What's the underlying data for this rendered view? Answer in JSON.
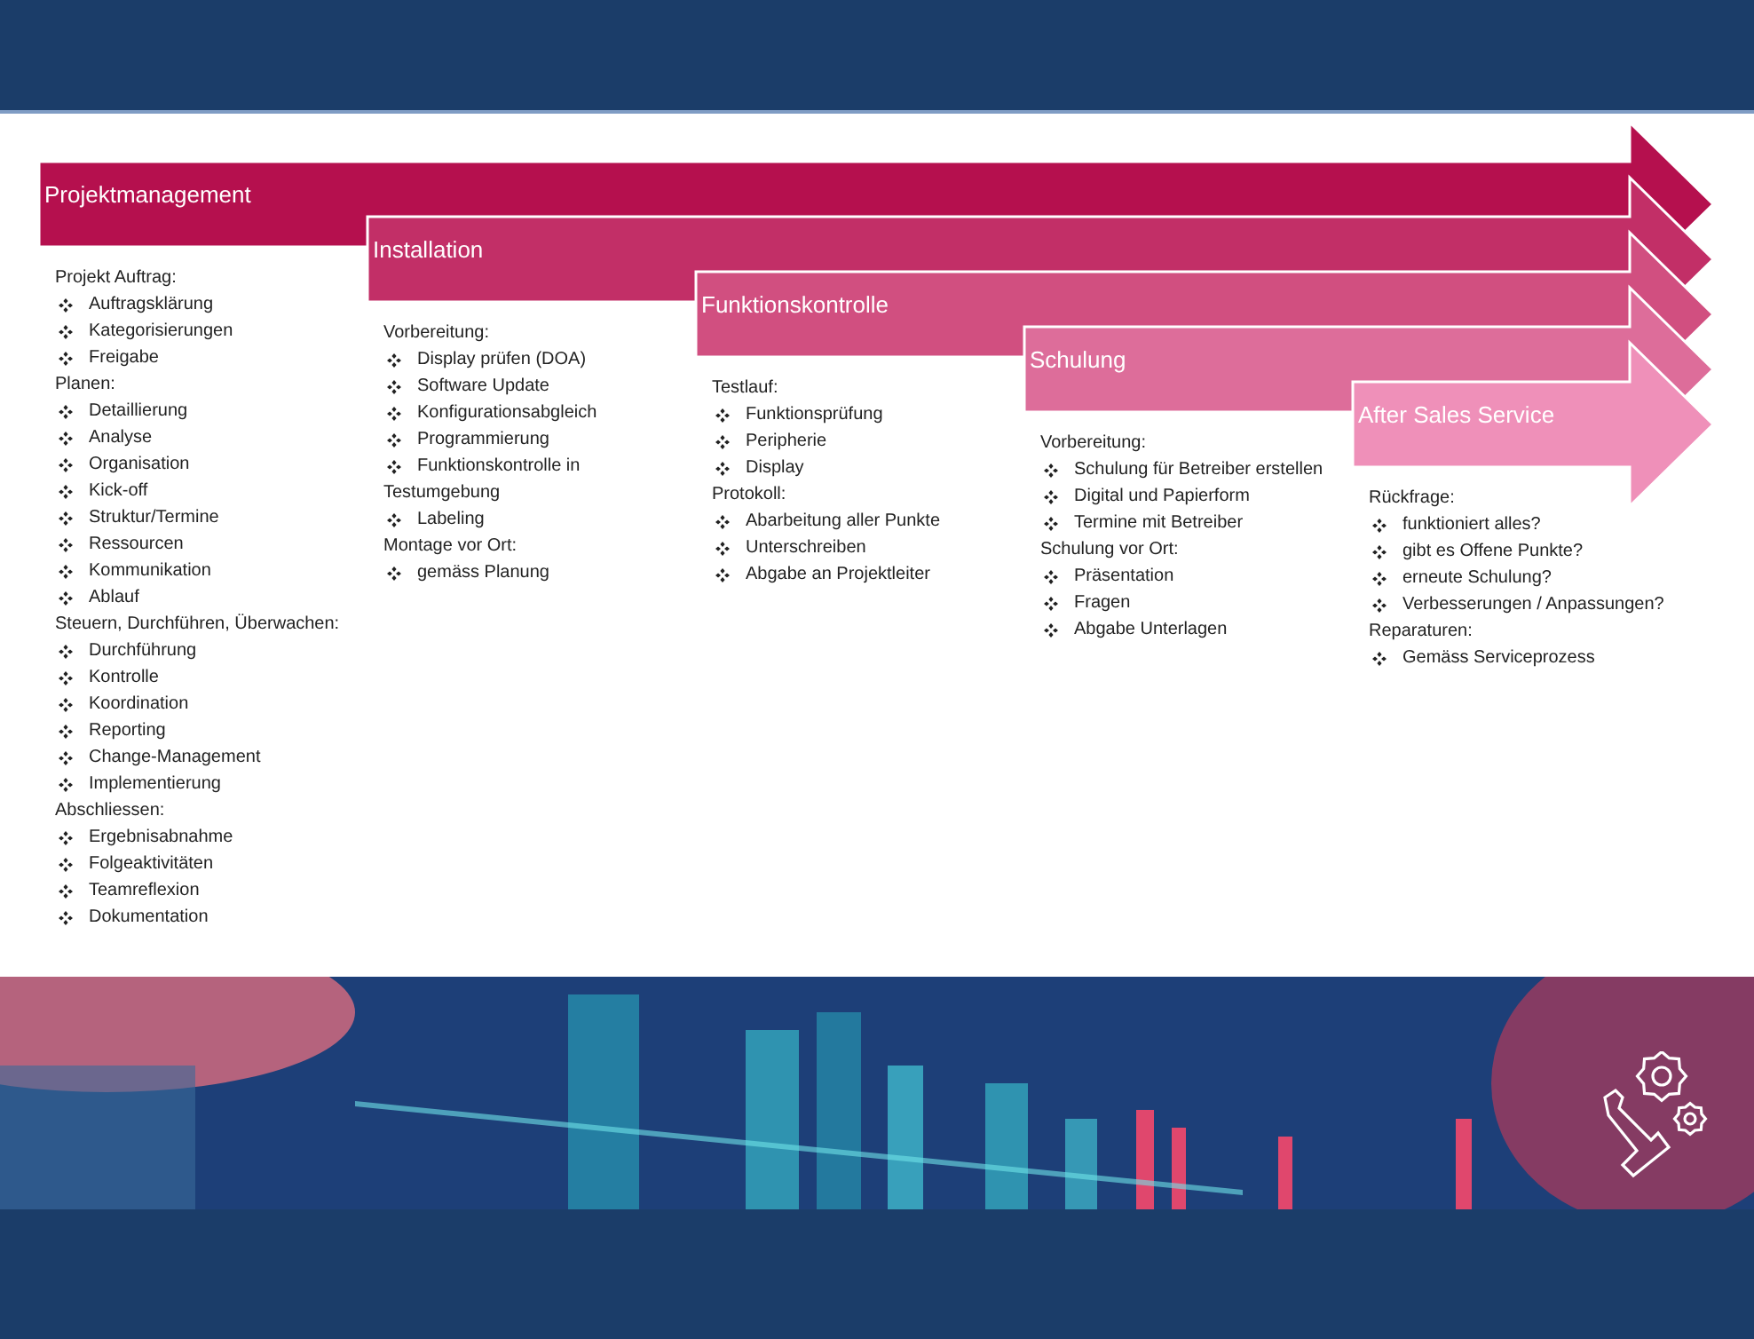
{
  "stages": [
    {
      "title": "Projektmanagement",
      "color": "#b5104e",
      "lines": [
        {
          "kind": "heading",
          "text": "Projekt Auftrag:"
        },
        {
          "kind": "bullet",
          "text": "Auftragsklärung"
        },
        {
          "kind": "bullet",
          "text": "Kategorisierungen"
        },
        {
          "kind": "bullet",
          "text": "Freigabe"
        },
        {
          "kind": "heading",
          "text": "Planen:"
        },
        {
          "kind": "bullet",
          "text": "Detaillierung"
        },
        {
          "kind": "bullet",
          "text": "Analyse"
        },
        {
          "kind": "bullet",
          "text": "Organisation"
        },
        {
          "kind": "bullet",
          "text": "Kick-off"
        },
        {
          "kind": "bullet",
          "text": "Struktur/Termine"
        },
        {
          "kind": "bullet",
          "text": "Ressourcen"
        },
        {
          "kind": "bullet",
          "text": "Kommunikation"
        },
        {
          "kind": "bullet",
          "text": "Ablauf"
        },
        {
          "kind": "heading",
          "text": "Steuern, Durchführen, Überwachen:"
        },
        {
          "kind": "bullet",
          "text": "Durchführung"
        },
        {
          "kind": "bullet",
          "text": "Kontrolle"
        },
        {
          "kind": "bullet",
          "text": "Koordination"
        },
        {
          "kind": "bullet",
          "text": "Reporting"
        },
        {
          "kind": "bullet",
          "text": "Change-Management"
        },
        {
          "kind": "bullet",
          "text": "Implementierung"
        },
        {
          "kind": "heading",
          "text": "Abschliessen:"
        },
        {
          "kind": "bullet",
          "text": "Ergebnisabnahme"
        },
        {
          "kind": "bullet",
          "text": "Folgeaktivitäten"
        },
        {
          "kind": "bullet",
          "text": "Teamreflexion"
        },
        {
          "kind": "bullet",
          "text": "Dokumentation"
        }
      ]
    },
    {
      "title": "Installation",
      "color": "#c22f67",
      "lines": [
        {
          "kind": "heading",
          "text": "Vorbereitung:"
        },
        {
          "kind": "bullet",
          "text": "Display prüfen (DOA)"
        },
        {
          "kind": "bullet",
          "text": "Software Update"
        },
        {
          "kind": "bullet",
          "text": "Konfigurationsabgleich"
        },
        {
          "kind": "bullet",
          "text": "Programmierung"
        },
        {
          "kind": "bullet",
          "text": "Funktionskontrolle in"
        },
        {
          "kind": "heading",
          "text": "Testumgebung"
        },
        {
          "kind": "bullet",
          "text": "Labeling"
        },
        {
          "kind": "heading",
          "text": "Montage vor Ort:"
        },
        {
          "kind": "bullet",
          "text": "gemäss Planung"
        }
      ]
    },
    {
      "title": "Funktionskontrolle",
      "color": "#d14f80",
      "lines": [
        {
          "kind": "heading",
          "text": "Testlauf:"
        },
        {
          "kind": "bullet",
          "text": "Funktionsprüfung"
        },
        {
          "kind": "bullet",
          "text": "Peripherie"
        },
        {
          "kind": "bullet",
          "text": "Display"
        },
        {
          "kind": "heading",
          "text": "Protokoll:"
        },
        {
          "kind": "bullet",
          "text": "Abarbeitung aller Punkte"
        },
        {
          "kind": "bullet",
          "text": "Unterschreiben"
        },
        {
          "kind": "bullet",
          "text": "Abgabe an Projektleiter"
        }
      ]
    },
    {
      "title": "Schulung",
      "color": "#dd6d9a",
      "lines": [
        {
          "kind": "heading",
          "text": "Vorbereitung:"
        },
        {
          "kind": "bullet",
          "text": "Schulung für Betreiber erstellen"
        },
        {
          "kind": "bullet",
          "text": "Digital und Papierform"
        },
        {
          "kind": "bullet",
          "text": "Termine mit Betreiber"
        },
        {
          "kind": "heading",
          "text": "Schulung vor Ort:"
        },
        {
          "kind": "bullet",
          "text": "Präsentation"
        },
        {
          "kind": "bullet",
          "text": "Fragen"
        },
        {
          "kind": "bullet",
          "text": "Abgabe Unterlagen"
        }
      ]
    },
    {
      "title": "After Sales Service",
      "color": "#ef90b9",
      "lines": [
        {
          "kind": "heading",
          "text": "Rückfrage:"
        },
        {
          "kind": "bullet",
          "text": "funktioniert alles?"
        },
        {
          "kind": "bullet",
          "text": "gibt es Offene Punkte?"
        },
        {
          "kind": "bullet",
          "text": "erneute Schulung?"
        },
        {
          "kind": "bullet",
          "text": "Verbesserungen / Anpassungen?"
        },
        {
          "kind": "heading",
          "text": "Reparaturen:"
        },
        {
          "kind": "bullet",
          "text": "Gemäss Serviceprozess"
        }
      ]
    }
  ]
}
